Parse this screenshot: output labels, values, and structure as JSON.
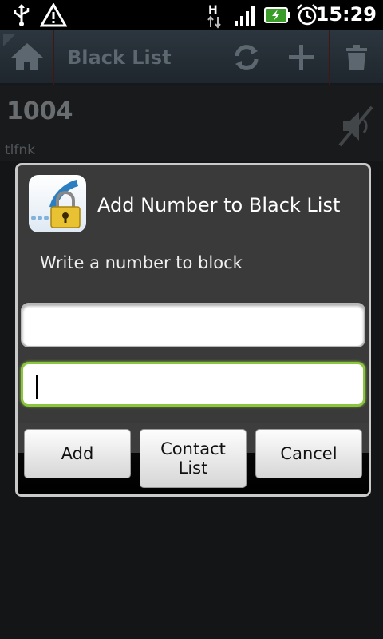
{
  "status_bar": {
    "time": "15:29",
    "icons": [
      "usb-icon",
      "warning-icon",
      "hspa-data-icon",
      "signal-icon",
      "battery-charging-icon",
      "alarm-icon"
    ]
  },
  "action_bar": {
    "title": "Black List",
    "buttons": [
      "home-icon",
      "refresh-icon",
      "add-icon",
      "trash-icon"
    ]
  },
  "list": [
    {
      "number": "1004",
      "name": "tlfnk",
      "icon": "muted-speaker-icon"
    }
  ],
  "dialog": {
    "title": "Add Number to Black List",
    "message": "Write a number to block",
    "field1_value": "",
    "field2_value": "",
    "buttons": {
      "add": "Add",
      "contact_list_line1": "Contact",
      "contact_list_line2": "List",
      "cancel": "Cancel"
    }
  },
  "colors": {
    "focus": "#8cc63f",
    "actionbar": "#34414b",
    "background": "#1b1c1e"
  }
}
